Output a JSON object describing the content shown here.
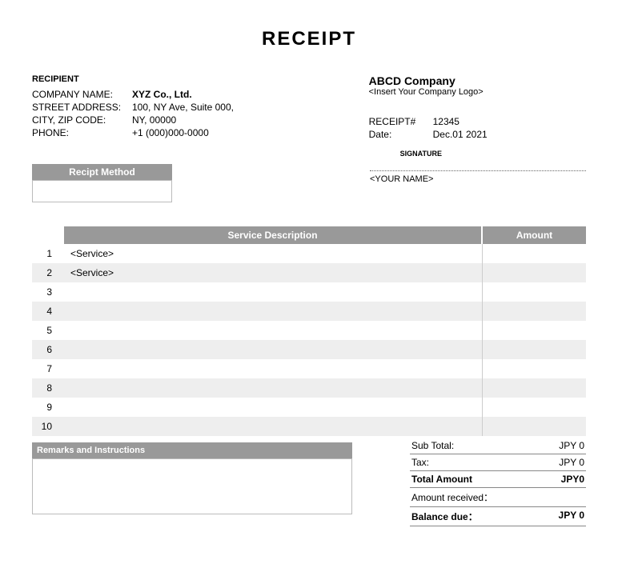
{
  "title": "RECEIPT",
  "recipient": {
    "section_label": "RECIPIENT",
    "fields": {
      "company_label": "COMPANY NAME:",
      "company_value": "XYZ Co., Ltd.",
      "street_label": "STREET ADDRESS:",
      "street_value": "100, NY Ave, Suite 000,",
      "city_label": "CITY, ZIP CODE:",
      "city_value": "NY, 00000",
      "phone_label": "PHONE:",
      "phone_value": "+1 (000)000-0000"
    }
  },
  "company": {
    "name": "ABCD Company",
    "logo_placeholder": "<Insert Your Company Logo>",
    "receipt_no_label": "RECEIPT#",
    "receipt_no_value": "12345",
    "date_label": "Date:",
    "date_value": "Dec.01 2021"
  },
  "signature": {
    "label": "SIGNATURE",
    "name_placeholder": "<YOUR NAME>"
  },
  "method": {
    "header": "Recipt Method",
    "value": ""
  },
  "items": {
    "headers": {
      "desc": "Service Description",
      "amount": "Amount"
    },
    "rows": [
      {
        "no": "1",
        "desc": "<Service>",
        "amount": ""
      },
      {
        "no": "2",
        "desc": "<Service>",
        "amount": ""
      },
      {
        "no": "3",
        "desc": "",
        "amount": ""
      },
      {
        "no": "4",
        "desc": "",
        "amount": ""
      },
      {
        "no": "5",
        "desc": "",
        "amount": ""
      },
      {
        "no": "6",
        "desc": "",
        "amount": ""
      },
      {
        "no": "7",
        "desc": "",
        "amount": ""
      },
      {
        "no": "8",
        "desc": "",
        "amount": ""
      },
      {
        "no": "9",
        "desc": "",
        "amount": ""
      },
      {
        "no": "10",
        "desc": "",
        "amount": ""
      }
    ]
  },
  "remarks": {
    "header": "Remarks and Instructions",
    "body": ""
  },
  "totals": {
    "subtotal_label": "Sub Total:",
    "subtotal_value": "JPY 0",
    "tax_label": "Tax:",
    "tax_value": "JPY 0",
    "total_label": "Total Amount",
    "total_value": "JPY0",
    "received_label": "Amount received：",
    "received_value": "",
    "balance_label": "Balance due：",
    "balance_value": "JPY 0"
  }
}
